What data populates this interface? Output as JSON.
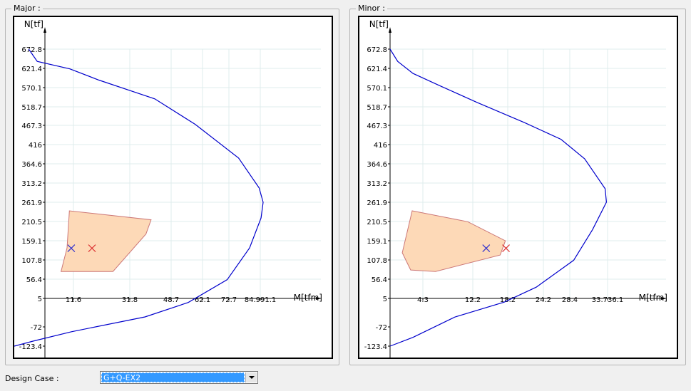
{
  "chart_data": [
    {
      "type": "line",
      "title": "Major :",
      "xlabel": "M[tfm]",
      "ylabel": "N[tf]",
      "x_ticks": [
        "11.6",
        "31.8",
        "48.7",
        "62.1",
        "72.7",
        "84.991.1"
      ],
      "y_ticks": [
        "672.8",
        "621.4",
        "570.1",
        "518.7",
        "467.3",
        "416",
        "364.6",
        "313.2",
        "261.9",
        "210.5",
        "159.1",
        "107.8",
        "56.4",
        "5",
        "-72",
        "-123.4"
      ],
      "curve": {
        "color": "#0000cc",
        "points": [
          [
            -12.4,
            -123.4
          ],
          [
            -8,
            -110
          ],
          [
            8,
            -85
          ],
          [
            38,
            -45
          ],
          [
            56,
            -6
          ],
          [
            72,
            55
          ],
          [
            84,
            140
          ],
          [
            90,
            220
          ],
          [
            91.1,
            261.9
          ],
          [
            89,
            300
          ],
          [
            78,
            380
          ],
          [
            59,
            470
          ],
          [
            42,
            540
          ],
          [
            23,
            590
          ],
          [
            5,
            620
          ],
          [
            -7,
            640
          ],
          [
            -9,
            672.8
          ]
        ]
      },
      "envelope": {
        "fill": "#fdd9b7",
        "stroke": "#cc7777",
        "points": [
          [
            0,
            140
          ],
          [
            4.2,
            239
          ],
          [
            40.5,
            215
          ],
          [
            38.4,
            177
          ],
          [
            27,
            77
          ],
          [
            -1.4,
            77
          ]
        ]
      },
      "markers": [
        {
          "label": "blue-x",
          "color": "#3333cc",
          "x": 7.6,
          "y": 139
        },
        {
          "label": "red-x",
          "color": "#dd3333",
          "x": 21,
          "y": 139
        }
      ]
    },
    {
      "type": "line",
      "title": "Minor :",
      "xlabel": "M[tfm]",
      "ylabel": "N[tf]",
      "x_ticks": [
        "4.3",
        "12.2",
        "18.2",
        "24.2",
        "28.4",
        "33.736.1"
      ],
      "y_ticks": [
        "672.8",
        "621.4",
        "570.1",
        "518.7",
        "467.3",
        "416",
        "364.6",
        "313.2",
        "261.9",
        "210.5",
        "159.1",
        "107.8",
        "56.4",
        "5",
        "-72",
        "-123.4"
      ],
      "curve": {
        "color": "#0000cc",
        "points": [
          [
            0,
            -123.4
          ],
          [
            3,
            -100
          ],
          [
            9.4,
            -45
          ],
          [
            17.6,
            -5
          ],
          [
            23,
            35
          ],
          [
            29.3,
            107
          ],
          [
            33.6,
            189
          ],
          [
            35.8,
            262
          ],
          [
            35.6,
            298
          ],
          [
            31.8,
            378
          ],
          [
            27,
            430
          ],
          [
            21,
            475
          ],
          [
            13,
            530
          ],
          [
            7,
            575
          ],
          [
            3,
            608
          ],
          [
            1,
            640
          ],
          [
            0,
            672.8
          ]
        ]
      },
      "envelope": {
        "fill": "#fdd9b7",
        "stroke": "#cc7777",
        "points": [
          [
            2.9,
            239
          ],
          [
            11.4,
            210
          ],
          [
            17.8,
            159
          ],
          [
            16.9,
            121
          ],
          [
            6.3,
            77
          ],
          [
            2.7,
            81
          ],
          [
            1.6,
            127
          ]
        ]
      },
      "markers": [
        {
          "label": "blue-x",
          "color": "#3333cc",
          "x": 14.5,
          "y": 139
        },
        {
          "label": "red-x",
          "color": "#dd3333",
          "x": 17.9,
          "y": 139
        }
      ]
    }
  ],
  "design_case": {
    "label": "Design Case :",
    "value": "G+Q-EX2"
  }
}
